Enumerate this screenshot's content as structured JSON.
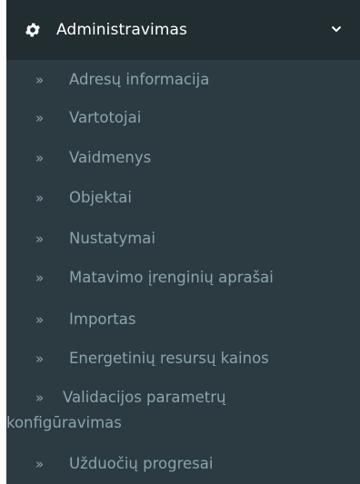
{
  "menu": {
    "header": {
      "icon": "gear-icon",
      "label": "Administravimas",
      "chevron_icon": "chevron-down-icon"
    },
    "arrow_glyph": "»",
    "items": [
      {
        "label": "Adresų informacija"
      },
      {
        "label": "Vartotojai"
      },
      {
        "label": "Vaidmenys"
      },
      {
        "label": "Objektai"
      },
      {
        "label": "Nustatymai"
      },
      {
        "label": "Matavimo įrenginių aprašai"
      },
      {
        "label": "Importas"
      },
      {
        "label": "Energetinių resursų kainos"
      },
      {
        "label": "Validacijos parametrų konfigūravimas"
      },
      {
        "label": "Užduočių progresai"
      }
    ],
    "colors": {
      "header_bg": "#222d32",
      "submenu_bg": "#2c3b41",
      "item_text": "#8aa4af",
      "header_text": "#ffffff"
    }
  }
}
